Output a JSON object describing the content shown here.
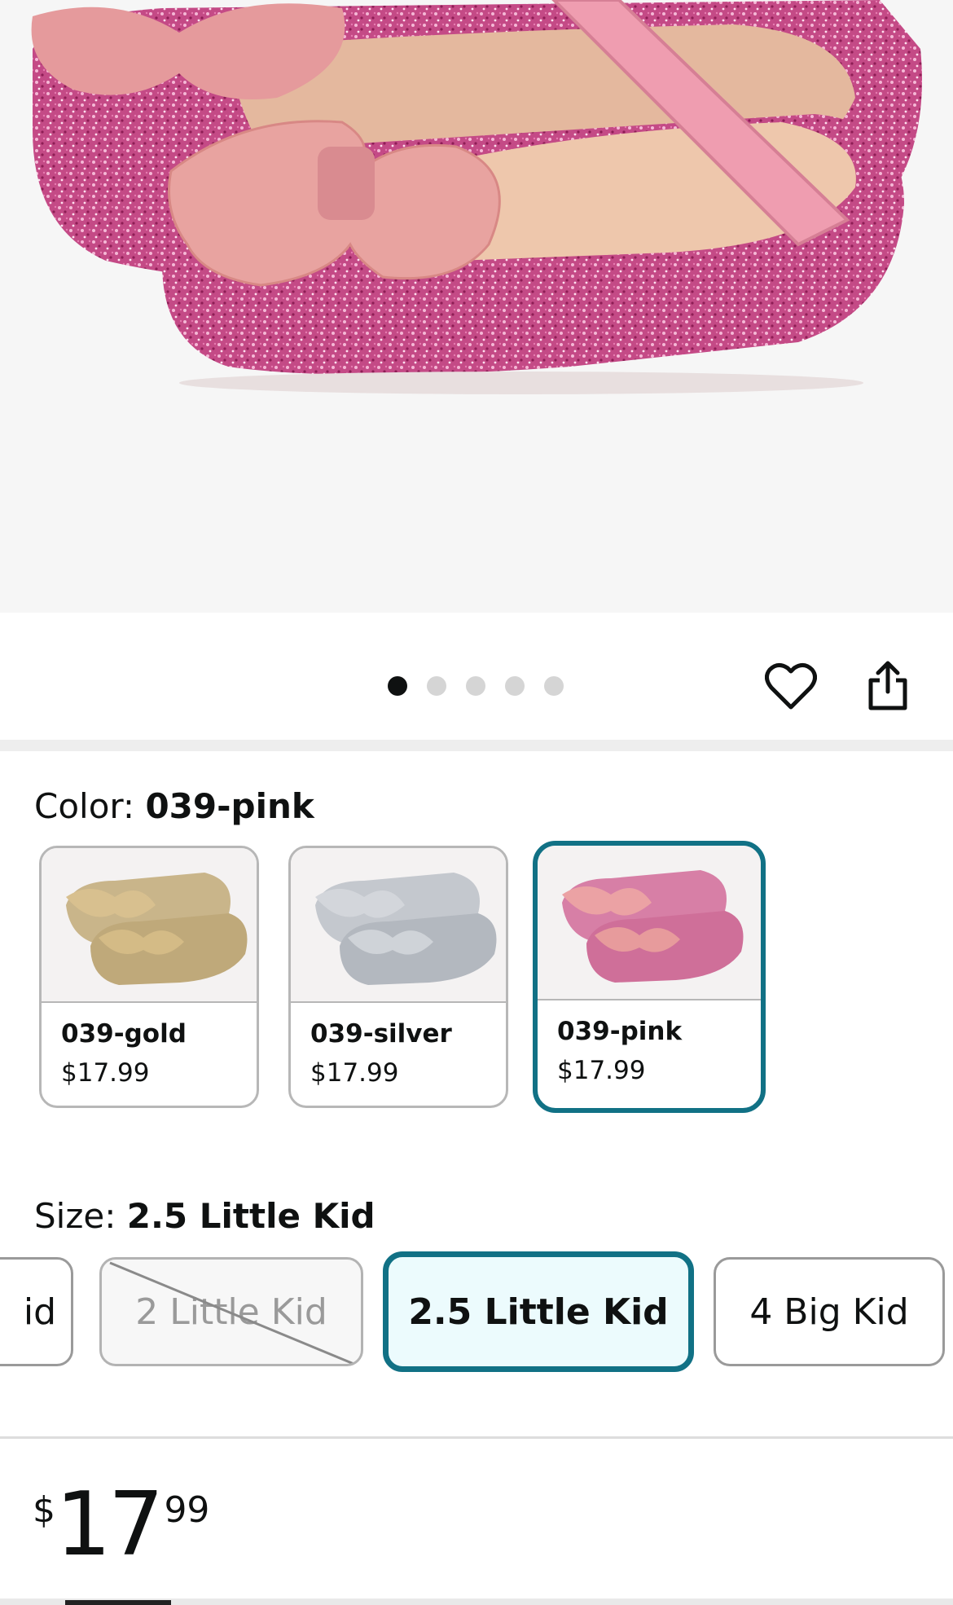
{
  "product_image": {
    "alt": "Pink glitter shoes with bows"
  },
  "gallery": {
    "image_count": 5,
    "active_index": 0
  },
  "actions": {
    "wishlist_icon": "heart-icon",
    "share_icon": "share-icon"
  },
  "color": {
    "label": "Color:",
    "selected_value": "039-pink",
    "options": [
      {
        "name": "039-gold",
        "price": "$17.99",
        "tone": "#cdb78a"
      },
      {
        "name": "039-silver",
        "price": "$17.99",
        "tone": "#bfc3c9"
      },
      {
        "name": "039-pink",
        "price": "$17.99",
        "tone": "#d98aa8"
      }
    ]
  },
  "size": {
    "label": "Size:",
    "selected_value": "2.5 Little Kid",
    "options": [
      {
        "label": "id",
        "state": "available"
      },
      {
        "label": "2 Little Kid",
        "state": "unavailable"
      },
      {
        "label": "2.5 Little Kid",
        "state": "selected"
      },
      {
        "label": "4 Big Kid",
        "state": "available"
      }
    ]
  },
  "price": {
    "symbol": "$",
    "whole": "17",
    "fraction": "99"
  },
  "colors": {
    "accent": "#117185",
    "selected_bg": "#ecfbfd"
  }
}
